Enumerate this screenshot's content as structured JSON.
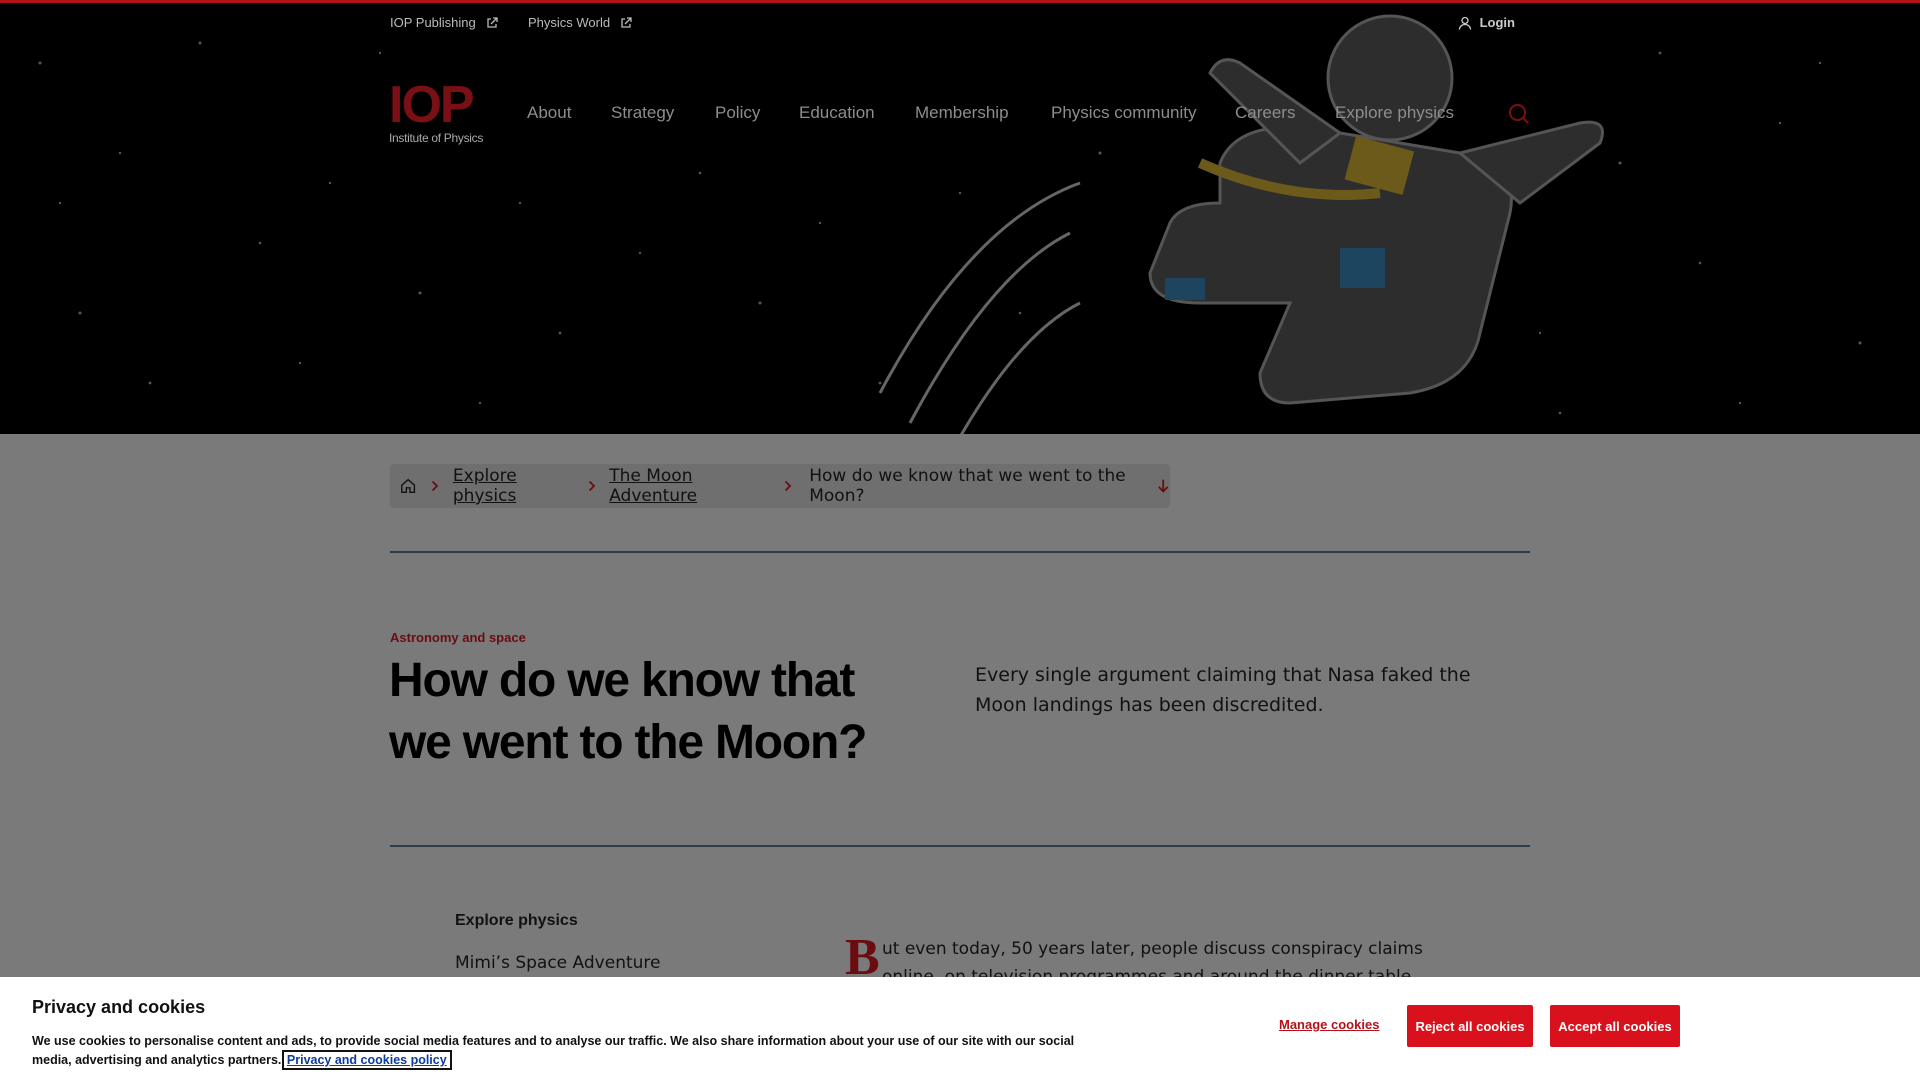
{
  "utility": {
    "iop_publishing": "IOP Publishing",
    "physics_world": "Physics World",
    "login": "Login"
  },
  "logo": {
    "letters": "IOP",
    "subtitle": "Institute of Physics"
  },
  "nav": [
    "About",
    "Strategy",
    "Policy",
    "Education",
    "Membership",
    "Physics community",
    "Careers",
    "Explore physics"
  ],
  "breadcrumb": {
    "home_icon": "home-icon",
    "items": [
      "Explore physics",
      "The Moon Adventure"
    ],
    "current": "How do we know that we went to the Moon?"
  },
  "article": {
    "kicker": "Astronomy and space",
    "title": "How do we know that we went to the Moon?",
    "standfirst": "Every single argument claiming that Nasa faked the Moon landings has been discredited.",
    "dropcap": "B",
    "body": "ut even today, 50 years later, people discuss conspiracy claims online, on television programmes and around the dinner table."
  },
  "sidebar": {
    "title": "Explore physics",
    "items": [
      "Mimi’s Space Adventure"
    ]
  },
  "cookie": {
    "title": "Privacy and cookies",
    "text": "We use cookies to personalise content and ads, to provide social media features and to analyse our traffic. We also share information about your use of our site with our social media, advertising and analytics partners.",
    "policy_link": "Privacy and cookies policy",
    "manage": "Manage cookies",
    "reject": "Reject all cookies",
    "accept": "Accept all cookies"
  },
  "colors": {
    "brand_red": "#d9111c",
    "rule": "#2d3e4a"
  }
}
